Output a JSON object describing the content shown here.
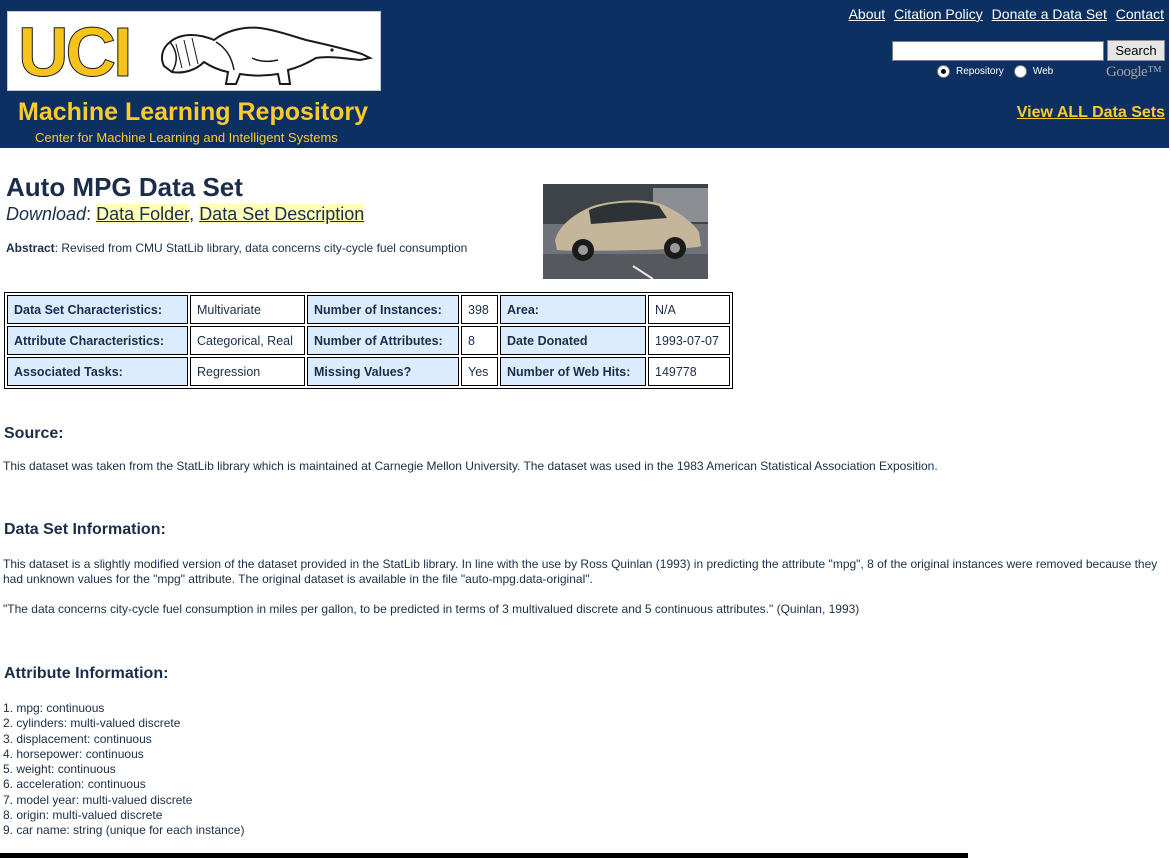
{
  "header": {
    "logo_text": "UCI",
    "repo_title": "Machine Learning Repository",
    "repo_subtitle": "Center for Machine Learning and Intelligent Systems",
    "links": [
      "About",
      "Citation Policy",
      "Donate a Data Set",
      "Contact"
    ],
    "search": {
      "placeholder": "",
      "button": "Search",
      "radio_repository": "Repository",
      "radio_web": "Web",
      "selected": "Repository",
      "provider": "Google™"
    },
    "view_all": "View ALL Data Sets"
  },
  "dataset": {
    "title": "Auto MPG Data Set",
    "download_label": "Download",
    "download_sep_1": ":",
    "download_sep_2": ",",
    "download_links": [
      "Data Folder",
      "Data Set Description"
    ],
    "abstract_label": "Abstract",
    "abstract_text": ": Revised from CMU StatLib library, data concerns city-cycle fuel consumption"
  },
  "properties": [
    [
      {
        "label": "Data Set Characteristics:",
        "value": "Multivariate"
      },
      {
        "label": "Number of Instances:",
        "value": "398"
      },
      {
        "label": "Area:",
        "value": "N/A"
      }
    ],
    [
      {
        "label": "Attribute Characteristics:",
        "value": "Categorical, Real"
      },
      {
        "label": "Number of Attributes:",
        "value": "8"
      },
      {
        "label": "Date Donated",
        "value": "1993-07-07"
      }
    ],
    [
      {
        "label": "Associated Tasks:",
        "value": "Regression"
      },
      {
        "label": "Missing Values?",
        "value": "Yes"
      },
      {
        "label": "Number of Web Hits:",
        "value": "149778"
      }
    ]
  ],
  "source": {
    "heading": "Source:",
    "text": "This dataset was taken from the StatLib library which is maintained at Carnegie Mellon University. The dataset was used in the 1983 American Statistical Association Exposition."
  },
  "info": {
    "heading": "Data Set Information:",
    "p1": "This dataset is a slightly modified version of the dataset provided in the StatLib library. In line with the use by Ross Quinlan (1993) in predicting the attribute \"mpg\", 8 of the original instances were removed because they had unknown values for the \"mpg\" attribute. The original dataset is available in the file \"auto-mpg.data-original\".",
    "p2": "\"The data concerns city-cycle fuel consumption in miles per gallon, to be predicted in terms of 3 multivalued discrete and 5 continuous attributes.\" (Quinlan, 1993)"
  },
  "attributes": {
    "heading": "Attribute Information:",
    "items": [
      "1. mpg: continuous",
      "2. cylinders: multi-valued discrete",
      "3. displacement: continuous",
      "4. horsepower: continuous",
      "5. weight: continuous",
      "6. acceleration: continuous",
      "7. model year: multi-valued discrete",
      "8. origin: multi-valued discrete",
      "9. car name: string (unique for each instance)"
    ]
  }
}
